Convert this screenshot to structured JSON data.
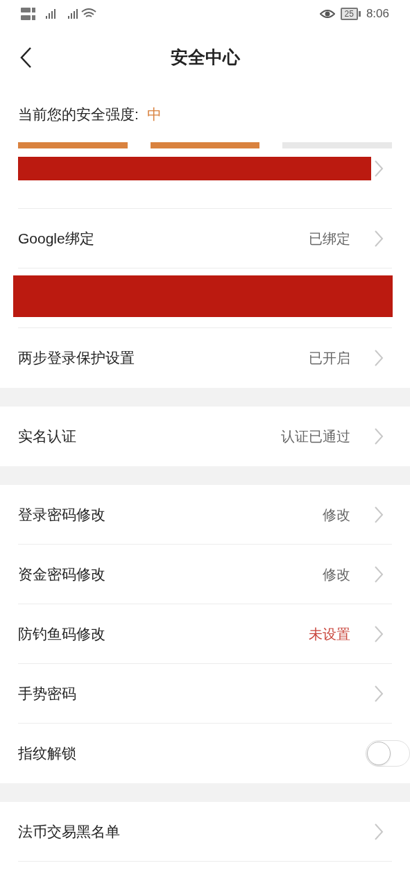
{
  "status_bar": {
    "battery": "25",
    "time": "8:06"
  },
  "header": {
    "title": "安全中心"
  },
  "strength": {
    "label": "当前您的安全强度:",
    "value": "中",
    "segments": [
      {
        "filled": true
      },
      {
        "filled": true
      },
      {
        "filled": false
      }
    ]
  },
  "groups": [
    {
      "rows": [
        {
          "kind": "redacted"
        },
        {
          "kind": "link",
          "label": "Google绑定",
          "value": "已绑定",
          "warning": false
        },
        {
          "kind": "redacted_wide"
        },
        {
          "kind": "link",
          "label": "两步登录保护设置",
          "value": "已开启",
          "warning": false
        }
      ]
    },
    {
      "rows": [
        {
          "kind": "link",
          "label": "实名认证",
          "value": "认证已通过",
          "warning": false
        }
      ]
    },
    {
      "rows": [
        {
          "kind": "link",
          "label": "登录密码修改",
          "value": "修改",
          "warning": false
        },
        {
          "kind": "link",
          "label": "资金密码修改",
          "value": "修改",
          "warning": false
        },
        {
          "kind": "link",
          "label": "防钓鱼码修改",
          "value": "未设置",
          "warning": true
        },
        {
          "kind": "link",
          "label": "手势密码"
        },
        {
          "kind": "toggle",
          "label": "指纹解锁",
          "on": false
        }
      ]
    },
    {
      "rows": [
        {
          "kind": "link",
          "label": "法币交易黑名单"
        }
      ]
    }
  ]
}
